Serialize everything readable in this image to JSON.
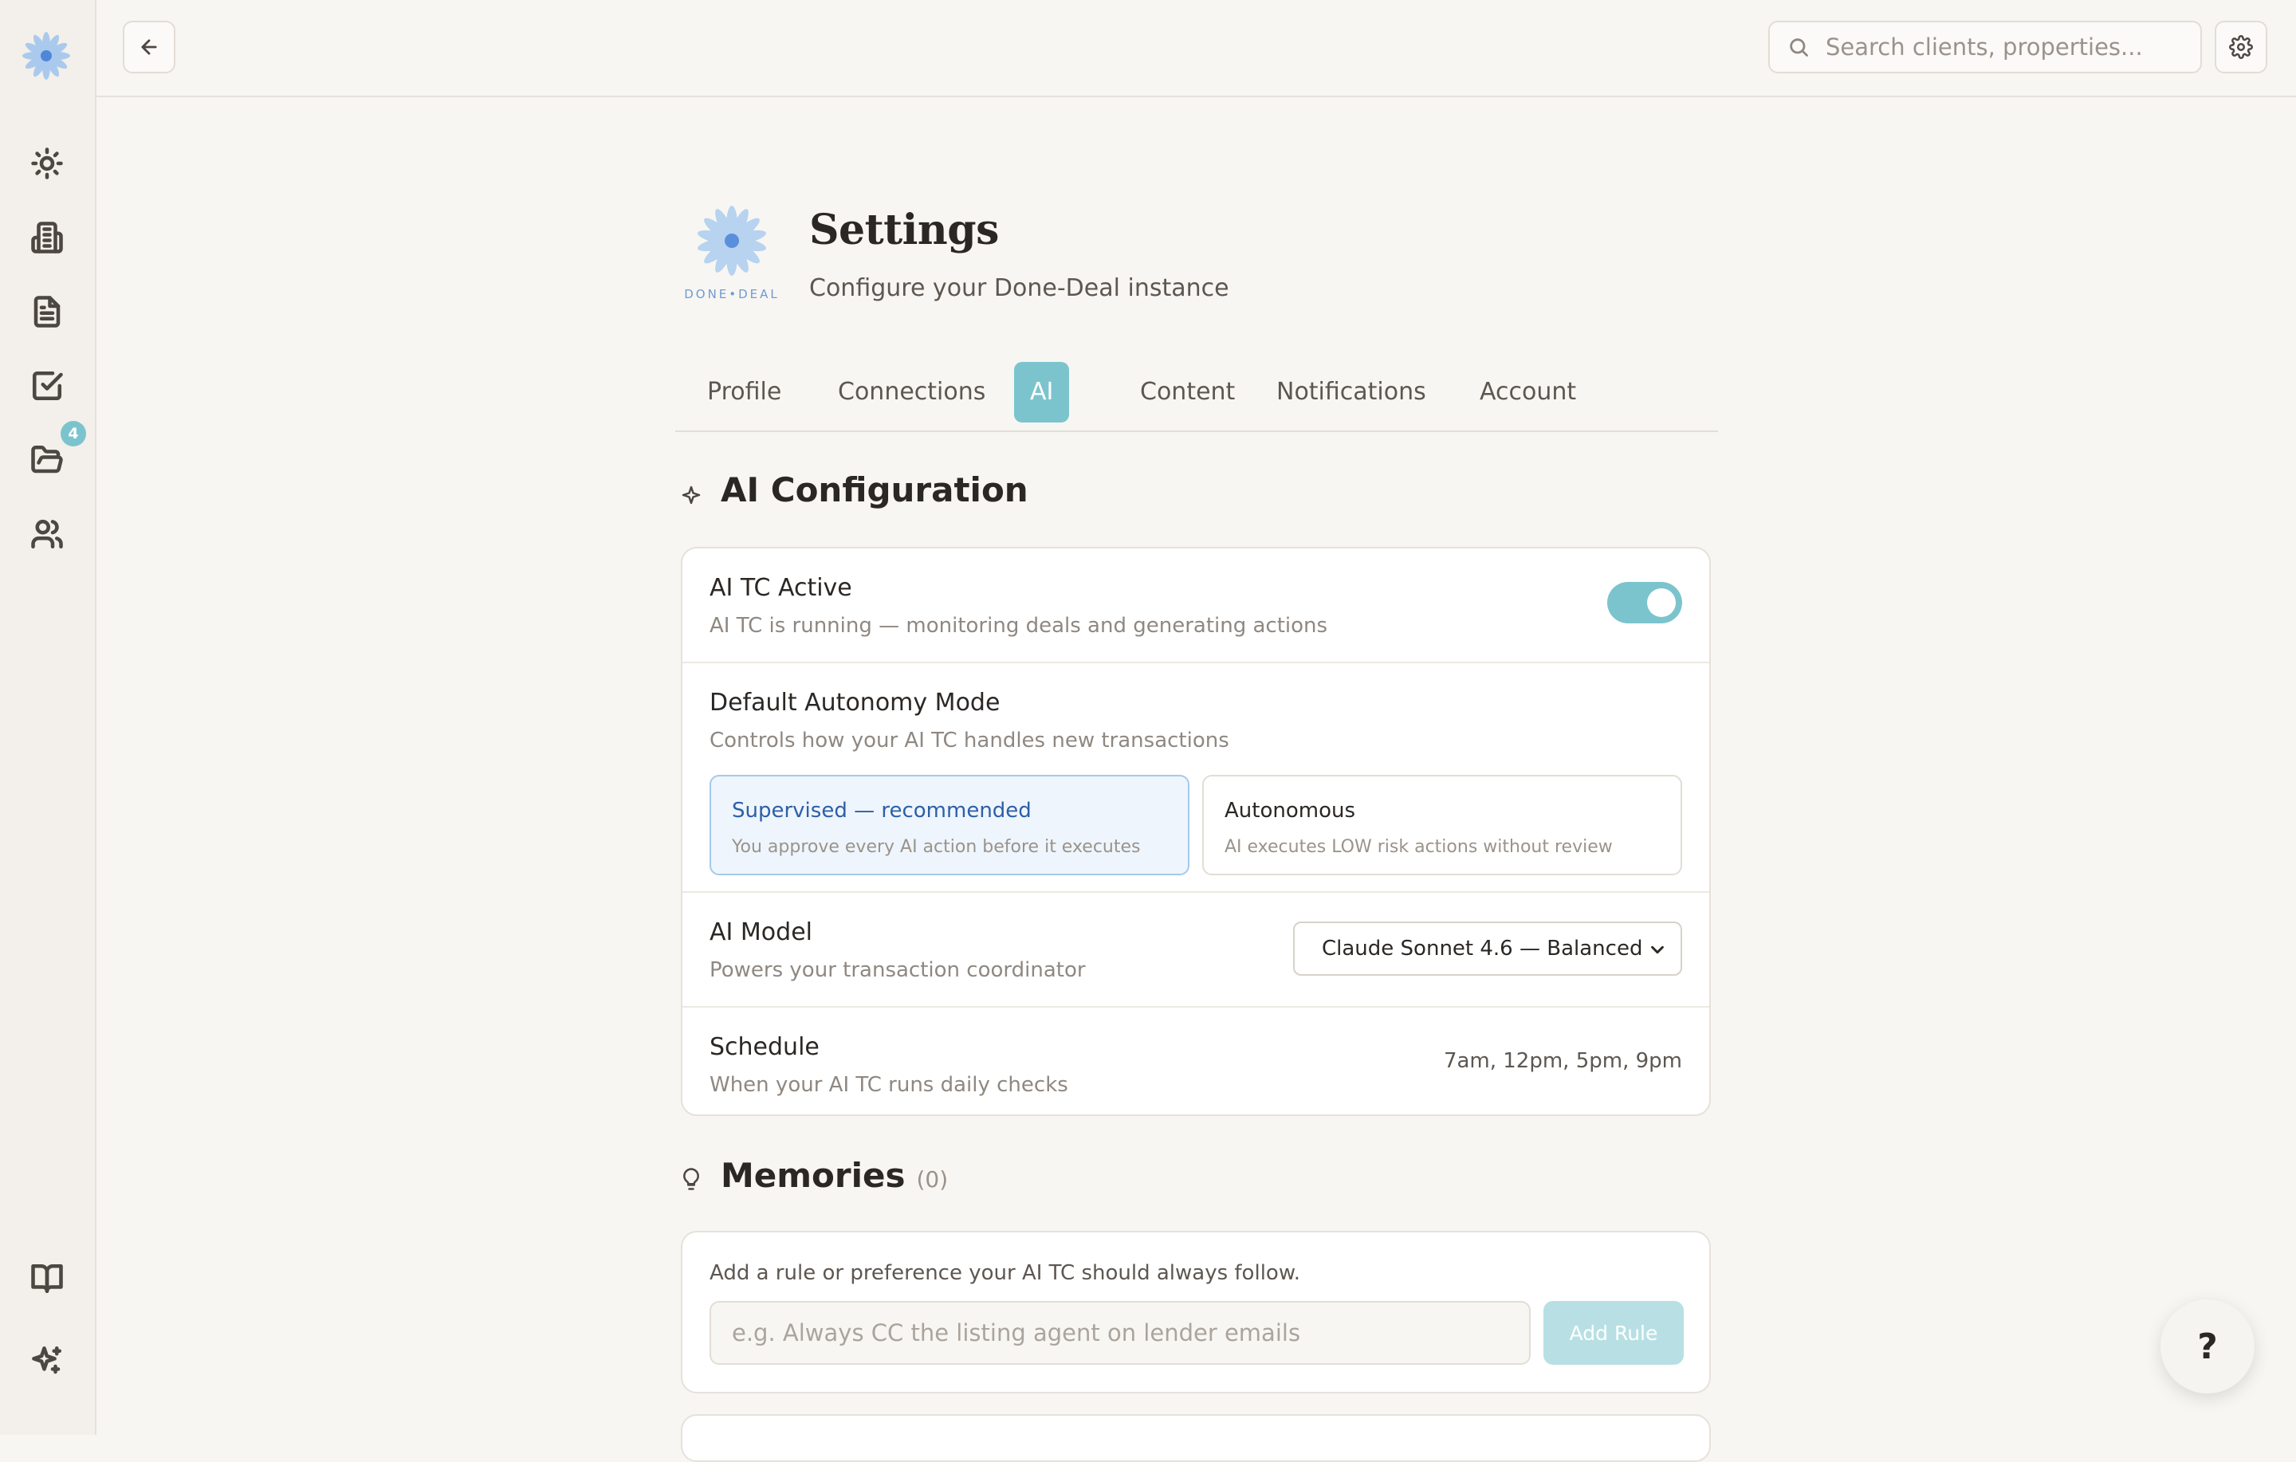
{
  "sidebar": {
    "badge_count": "4",
    "items": [
      {
        "icon": "sun-icon"
      },
      {
        "icon": "building-icon"
      },
      {
        "icon": "document-icon"
      },
      {
        "icon": "checkbox-icon"
      },
      {
        "icon": "folder-open-icon"
      },
      {
        "icon": "users-icon"
      },
      {
        "icon": "book-icon"
      },
      {
        "icon": "sparkles-icon"
      }
    ]
  },
  "topbar": {
    "search_placeholder": "Search clients, properties..."
  },
  "header": {
    "logo_text": "DONE•DEAL",
    "title": "Settings",
    "subtitle": "Configure your Done-Deal instance"
  },
  "tabs": [
    {
      "label": "Profile"
    },
    {
      "label": "Connections"
    },
    {
      "label": "AI",
      "active": true
    },
    {
      "label": "Content"
    },
    {
      "label": "Notifications"
    },
    {
      "label": "Account"
    }
  ],
  "ai_config": {
    "title": "AI Configuration",
    "active": {
      "label": "AI TC Active",
      "desc": "AI TC is running — monitoring deals and generating actions",
      "enabled": true
    },
    "autonomy": {
      "label": "Default Autonomy Mode",
      "desc": "Controls how your AI TC handles new transactions",
      "options": [
        {
          "title": "Supervised — recommended",
          "desc": "You approve every AI action before it executes",
          "selected": true
        },
        {
          "title": "Autonomous",
          "desc": "AI executes LOW risk actions without review",
          "selected": false
        }
      ]
    },
    "model": {
      "label": "AI Model",
      "desc": "Powers your transaction coordinator",
      "value": "Claude Sonnet 4.6 — Balanced"
    },
    "schedule": {
      "label": "Schedule",
      "desc": "When your AI TC runs daily checks",
      "value": "7am, 12pm, 5pm, 9pm"
    }
  },
  "memories": {
    "title": "Memories",
    "count": "(0)",
    "hint": "Add a rule or preference your AI TC should always follow.",
    "input_placeholder": "e.g. Always CC the listing agent on lender emails",
    "add_label": "Add Rule"
  },
  "help_label": "?"
}
